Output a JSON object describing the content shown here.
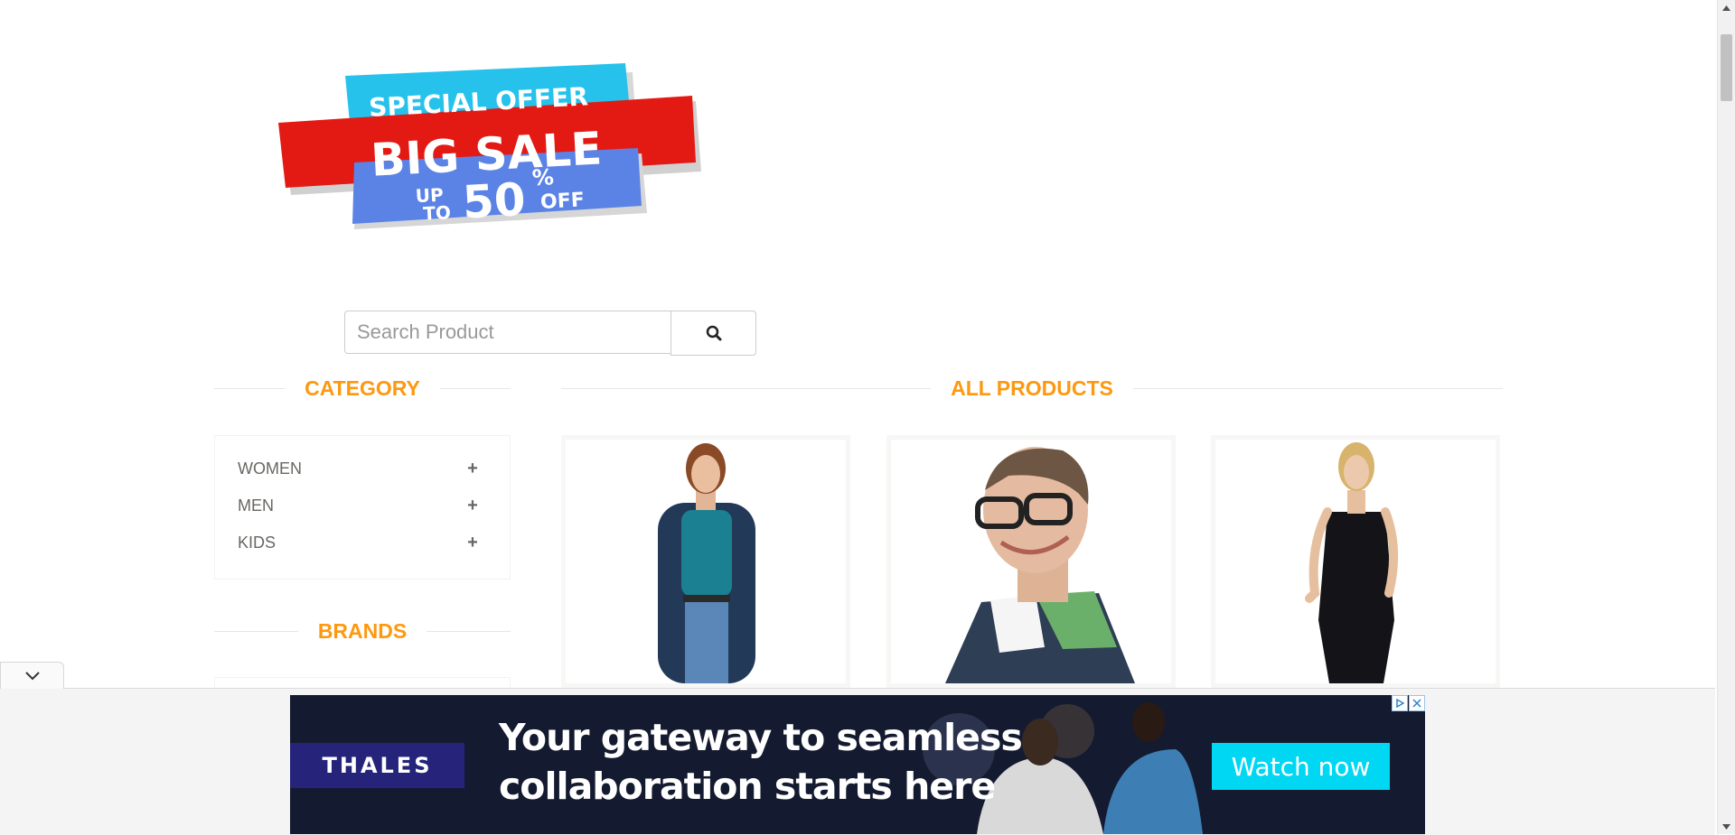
{
  "banner": {
    "line1": "SPECIAL OFFER",
    "line2": "BIG SALE",
    "up": "UP",
    "to": "TO",
    "amount": "50",
    "percent": "%",
    "off": "OFF"
  },
  "search": {
    "placeholder": "Search Product",
    "button_icon": "search-icon"
  },
  "sidebar": {
    "category_title": "CATEGORY",
    "categories": [
      {
        "label": "WOMEN",
        "icon": "plus-icon"
      },
      {
        "label": "MEN",
        "icon": "plus-icon"
      },
      {
        "label": "KIDS",
        "icon": "plus-icon"
      }
    ],
    "plus_glyph": "+",
    "brands_title": "BRANDS"
  },
  "main": {
    "products_title": "ALL PRODUCTS",
    "products": [
      {
        "image": "woman-teal-top-photo"
      },
      {
        "image": "man-glasses-photo"
      },
      {
        "image": "woman-black-dress-photo"
      }
    ]
  },
  "ad": {
    "logo": "THALES",
    "headline_line1": "Your gateway to seamless",
    "headline_line2": "collaboration starts here",
    "cta": "Watch now",
    "colors": {
      "accent": "#00D7F3",
      "logo_bg": "#25237a"
    }
  },
  "colors": {
    "section_title": "#FE980F",
    "text": "#696763"
  }
}
